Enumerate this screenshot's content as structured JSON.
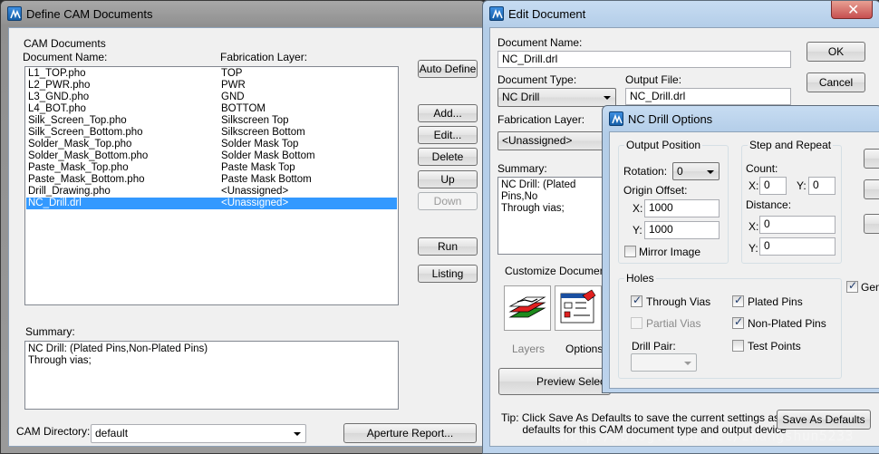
{
  "define_cam": {
    "title": "Define CAM Documents",
    "section_label": "CAM Documents",
    "col_doc_name": "Document Name:",
    "col_fab_layer": "Fabrication Layer:",
    "rows": [
      {
        "name": "L1_TOP.pho",
        "layer": "TOP"
      },
      {
        "name": "L2_PWR.pho",
        "layer": "PWR"
      },
      {
        "name": "L3_GND.pho",
        "layer": "GND"
      },
      {
        "name": "L4_BOT.pho",
        "layer": "BOTTOM"
      },
      {
        "name": "Silk_Screen_Top.pho",
        "layer": "Silkscreen Top"
      },
      {
        "name": "Silk_Screen_Bottom.pho",
        "layer": "Silkscreen Bottom"
      },
      {
        "name": "Solder_Mask_Top.pho",
        "layer": "Solder Mask Top"
      },
      {
        "name": "Solder_Mask_Bottom.pho",
        "layer": "Solder Mask Bottom"
      },
      {
        "name": "Paste_Mask_Top.pho",
        "layer": "Paste Mask Top"
      },
      {
        "name": "Paste_Mask_Bottom.pho",
        "layer": "Paste Mask Bottom"
      },
      {
        "name": "Drill_Drawing.pho",
        "layer": "<Unassigned>"
      },
      {
        "name": "NC_Drill.drl",
        "layer": "<Unassigned>"
      }
    ],
    "selected_row": "NC_Drill.drl",
    "buttons": {
      "auto_define": "Auto Define",
      "add": "Add...",
      "edit": "Edit...",
      "delete": "Delete",
      "up": "Up",
      "down": "Down",
      "run": "Run",
      "listing": "Listing",
      "aperture_report": "Aperture Report..."
    },
    "summary_label": "Summary:",
    "summary_text": "NC Drill: (Plated Pins,Non-Plated Pins)\nThrough vias;",
    "cam_dir_label": "CAM Directory:",
    "cam_dir_value": "default"
  },
  "edit_doc": {
    "title": "Edit Document",
    "doc_name_label": "Document Name:",
    "doc_name_value": "NC_Drill.drl",
    "doc_type_label": "Document Type:",
    "doc_type_value": "NC Drill",
    "output_file_label": "Output File:",
    "output_file_value": "NC_Drill.drl",
    "fab_layer_label": "Fabrication Layer:",
    "fab_layer_value": "<Unassigned>",
    "summary_label": "Summary:",
    "summary_text": "NC Drill: (Plated Pins,No\nThrough vias;",
    "ok": "OK",
    "cancel": "Cancel",
    "customize_label": "Customize Document",
    "layers_label": "Layers",
    "options_label": "Options",
    "preview_label": "Preview Selectio",
    "tip_text": "Tip: Click Save As Defaults to save the current settings as the\n       defaults for this CAM document type and output device",
    "save_defaults": "Save As Defaults"
  },
  "nc_drill": {
    "title": "NC Drill Options",
    "output_position_label": "Output Position",
    "rotation_label": "Rotation:",
    "rotation_value": "0",
    "origin_offset_label": "Origin Offset:",
    "origin_x_label": "X:",
    "origin_x_value": "1000",
    "origin_y_label": "Y:",
    "origin_y_value": "1000",
    "mirror_label": "Mirror Image",
    "step_repeat_label": "Step and Repeat",
    "count_label": "Count:",
    "count_x_label": "X:",
    "count_x_value": "0",
    "count_y_label": "Y:",
    "count_y_value": "0",
    "distance_label": "Distance:",
    "dist_x_label": "X:",
    "dist_x_value": "0",
    "dist_y_label": "Y:",
    "dist_y_value": "0",
    "holes_label": "Holes",
    "through_vias": "Through Vias",
    "partial_vias": "Partial Vias",
    "plated_pins": "Plated Pins",
    "non_plated_pins": "Non-Plated Pins",
    "test_points": "Test Points",
    "drill_pair_label": "Drill Pair:",
    "generate_label": "Gene",
    "through_vias_checked": true,
    "partial_vias_checked": false,
    "plated_pins_checked": true,
    "non_plated_pins_checked": true,
    "test_points_checked": false,
    "mirror_checked": false,
    "generate_checked": true
  },
  "watermark": "http://blog.csdn.net/zhangshun5233",
  "colors": {
    "selection": "#3399ff",
    "frame_active": "#b9d1ea",
    "client": "#f0f0f0"
  }
}
